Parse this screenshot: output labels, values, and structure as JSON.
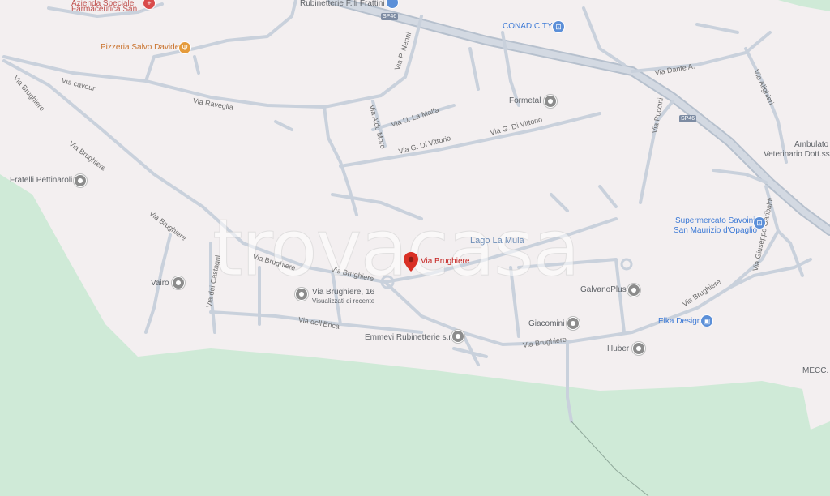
{
  "places": {
    "farmaceutica": "Farmaceutica San...",
    "azienda": "Azienda Speciale",
    "rubinetterie_top": "Rubinetterie F.lli Frattini",
    "pizzeria": "Pizzeria Salvo Davide",
    "conad": "CONAD CITY",
    "formetal": "Formetal",
    "ambulatorio1": "Ambulato",
    "ambulatorio2": "Veterinario Dott.ssa",
    "fratelli": "Fratelli Pettinaroli",
    "lago": "Lago La Mula",
    "supermercato1": "Supermercato Savoini",
    "supermercato2": "San Maurizio d'Opaglio",
    "vairo": "Vairo",
    "brughiere16": "Via Brughiere, 16",
    "visualizzati": "Visualizzati di recente",
    "selected": "Via Brughiere",
    "galvanoplus": "GalvanoPlus",
    "elka": "Elka Design",
    "giacomini": "Giacomini",
    "emmevi": "Emmevi Rubinetterie s.r.l",
    "huber": "Huber",
    "mecc": "MECC."
  },
  "roads": {
    "via_brughiere": "Via Brughiere",
    "via_cavour": "Via cavour",
    "via_raveglia": "Via Raveglia",
    "via_nenni": "Via P. Nenni",
    "via_moro": "Via Aldo Moro",
    "via_lamalfa": "Via U. La Malfa",
    "via_divittorio": "Via G. Di Vittorio",
    "via_dante": "Via Dante A.",
    "via_alighieri": "Via Alighieri",
    "via_puccini": "Via Puccini",
    "via_castagni": "Via dei Castagni",
    "via_erica": "Via dell'Erica",
    "via_garibaldi": "Via Giuseppe Garibaldi"
  },
  "shields": {
    "sp46": "SP46"
  },
  "watermark": "trovacasa",
  "colors": {
    "land": "#f3eff0",
    "forest": "#cfead7",
    "road": "#c9d1dc",
    "main_road": "#b6c0cd",
    "pin": "#d93025"
  }
}
